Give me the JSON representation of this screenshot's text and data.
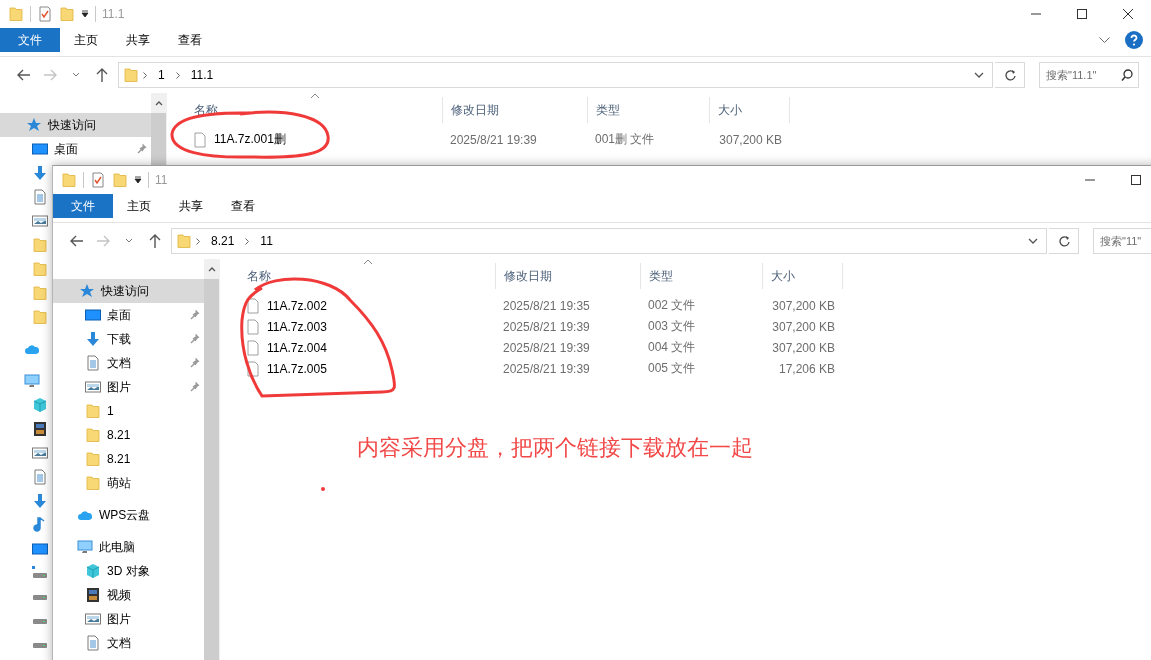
{
  "windows": [
    {
      "title": "11.1",
      "ribbon_buttons": [
        {
          "kind": "expand"
        },
        {
          "kind": "help"
        }
      ],
      "controls": [
        {
          "kind": "minimize"
        },
        {
          "kind": "maximize"
        },
        {
          "kind": "close"
        }
      ],
      "ribbon_tabs": [
        {
          "label": "文件",
          "selected": true
        },
        {
          "label": "主页",
          "selected": false
        },
        {
          "label": "共享",
          "selected": false
        },
        {
          "label": "查看",
          "selected": false
        }
      ],
      "address": {
        "path": [
          "1",
          "11.1"
        ]
      },
      "search": {
        "placeholder": "搜索\"11.1\""
      },
      "columns": [
        "名称",
        "修改日期",
        "类型",
        "大小"
      ],
      "files": [
        {
          "name": "11A.7z.001删",
          "modified": "2025/8/21 19:39",
          "type": "001删 文件",
          "size": "307,200 KB"
        }
      ],
      "nav": [
        {
          "kind": "star",
          "label": "快速访问",
          "selected": true,
          "children": [
            {
              "kind": "desktop",
              "label": "桌面",
              "pinned": true,
              "selected": false
            },
            {
              "kind": "download",
              "selected": false
            },
            {
              "kind": "document",
              "selected": false
            },
            {
              "kind": "picture",
              "selected": false
            },
            {
              "kind": "folder",
              "selected": false
            },
            {
              "kind": "folder",
              "selected": false
            },
            {
              "kind": "folder",
              "selected": false
            },
            {
              "kind": "folder",
              "selected": false
            }
          ]
        },
        {
          "kind": "cloud",
          "selected": false
        },
        {
          "kind": "pc",
          "selected": false,
          "children": [
            {
              "kind": "cube",
              "selected": false
            },
            {
              "kind": "video",
              "selected": false
            },
            {
              "kind": "picture",
              "selected": false
            },
            {
              "kind": "document",
              "selected": false
            },
            {
              "kind": "download",
              "selected": false
            },
            {
              "kind": "music",
              "selected": false
            },
            {
              "kind": "desktop",
              "selected": false
            },
            {
              "kind": "system_drive",
              "selected": false
            },
            {
              "kind": "drive",
              "selected": false
            },
            {
              "kind": "drive",
              "selected": false
            },
            {
              "kind": "drive",
              "selected": false
            }
          ]
        }
      ]
    },
    {
      "title": "11",
      "controls": [
        {
          "kind": "minimize"
        },
        {
          "kind": "maximize"
        }
      ],
      "ribbon_tabs": [
        {
          "label": "文件",
          "selected": true
        },
        {
          "label": "主页",
          "selected": false
        },
        {
          "label": "共享",
          "selected": false
        },
        {
          "label": "查看",
          "selected": false
        }
      ],
      "address": {
        "path": [
          "8.21",
          "11"
        ]
      },
      "search": {
        "placeholder": "搜索\"11\""
      },
      "columns": [
        "名称",
        "修改日期",
        "类型",
        "大小"
      ],
      "files": [
        {
          "name": "11A.7z.002",
          "modified": "2025/8/21 19:35",
          "type": "002 文件",
          "size": "307,200 KB"
        },
        {
          "name": "11A.7z.003",
          "modified": "2025/8/21 19:39",
          "type": "003 文件",
          "size": "307,200 KB"
        },
        {
          "name": "11A.7z.004",
          "modified": "2025/8/21 19:39",
          "type": "004 文件",
          "size": "307,200 KB"
        },
        {
          "name": "11A.7z.005",
          "modified": "2025/8/21 19:39",
          "type": "005 文件",
          "size": "17,206 KB"
        }
      ],
      "nav": [
        {
          "kind": "star",
          "label": "快速访问",
          "selected": true,
          "children": [
            {
              "kind": "desktop",
              "label": "桌面",
              "pinned": true,
              "selected": false
            },
            {
              "kind": "download",
              "label": "下载",
              "pinned": true,
              "selected": false
            },
            {
              "kind": "document",
              "label": "文档",
              "pinned": true,
              "selected": false
            },
            {
              "kind": "picture",
              "label": "图片",
              "pinned": true,
              "selected": false
            },
            {
              "kind": "folder",
              "label": "1",
              "pinned": false,
              "selected": false
            },
            {
              "kind": "folder",
              "label": "8.21",
              "pinned": false,
              "selected": false
            },
            {
              "kind": "folder",
              "label": "8.21",
              "pinned": false,
              "selected": false
            },
            {
              "kind": "folder",
              "label": "萌站",
              "pinned": false,
              "selected": false
            }
          ]
        },
        {
          "kind": "cloud",
          "label": "WPS云盘",
          "selected": false
        },
        {
          "kind": "pc",
          "label": "此电脑",
          "selected": false,
          "children": [
            {
              "kind": "cube",
              "label": "3D 对象",
              "selected": false
            },
            {
              "kind": "video",
              "label": "视频",
              "selected": false
            },
            {
              "kind": "picture",
              "label": "图片",
              "selected": false
            },
            {
              "kind": "document",
              "label": "文档",
              "selected": false
            }
          ]
        }
      ]
    }
  ],
  "annotation": {
    "note": "内容采用分盘，把两个链接下载放在一起"
  }
}
